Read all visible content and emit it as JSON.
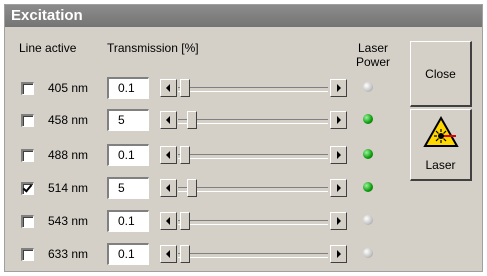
{
  "panel": {
    "title": "Excitation"
  },
  "headers": {
    "line_active": "Line active",
    "transmission": "Transmission [%]",
    "laser_power_line1": "Laser",
    "laser_power_line2": "Power"
  },
  "lines": [
    {
      "wavelength": "405 nm",
      "active": false,
      "transmission": "0.1",
      "level": 0.1,
      "laser_on": false
    },
    {
      "wavelength": "458 nm",
      "active": false,
      "transmission": "5",
      "level": 5,
      "laser_on": true
    },
    {
      "wavelength": "488 nm",
      "active": false,
      "transmission": "0.1",
      "level": 0.1,
      "laser_on": true
    },
    {
      "wavelength": "514 nm",
      "active": true,
      "transmission": "5",
      "level": 5,
      "laser_on": true
    },
    {
      "wavelength": "543 nm",
      "active": false,
      "transmission": "0.1",
      "level": 0.1,
      "laser_on": false
    },
    {
      "wavelength": "633 nm",
      "active": false,
      "transmission": "0.1",
      "level": 0.1,
      "laser_on": false
    }
  ],
  "buttons": {
    "close": "Close",
    "laser": "Laser"
  },
  "colors": {
    "led_on": "#0b9a0b",
    "led_off": "#c4c4c4",
    "warning_yellow": "#ffd800",
    "laser_red": "#e00000"
  }
}
